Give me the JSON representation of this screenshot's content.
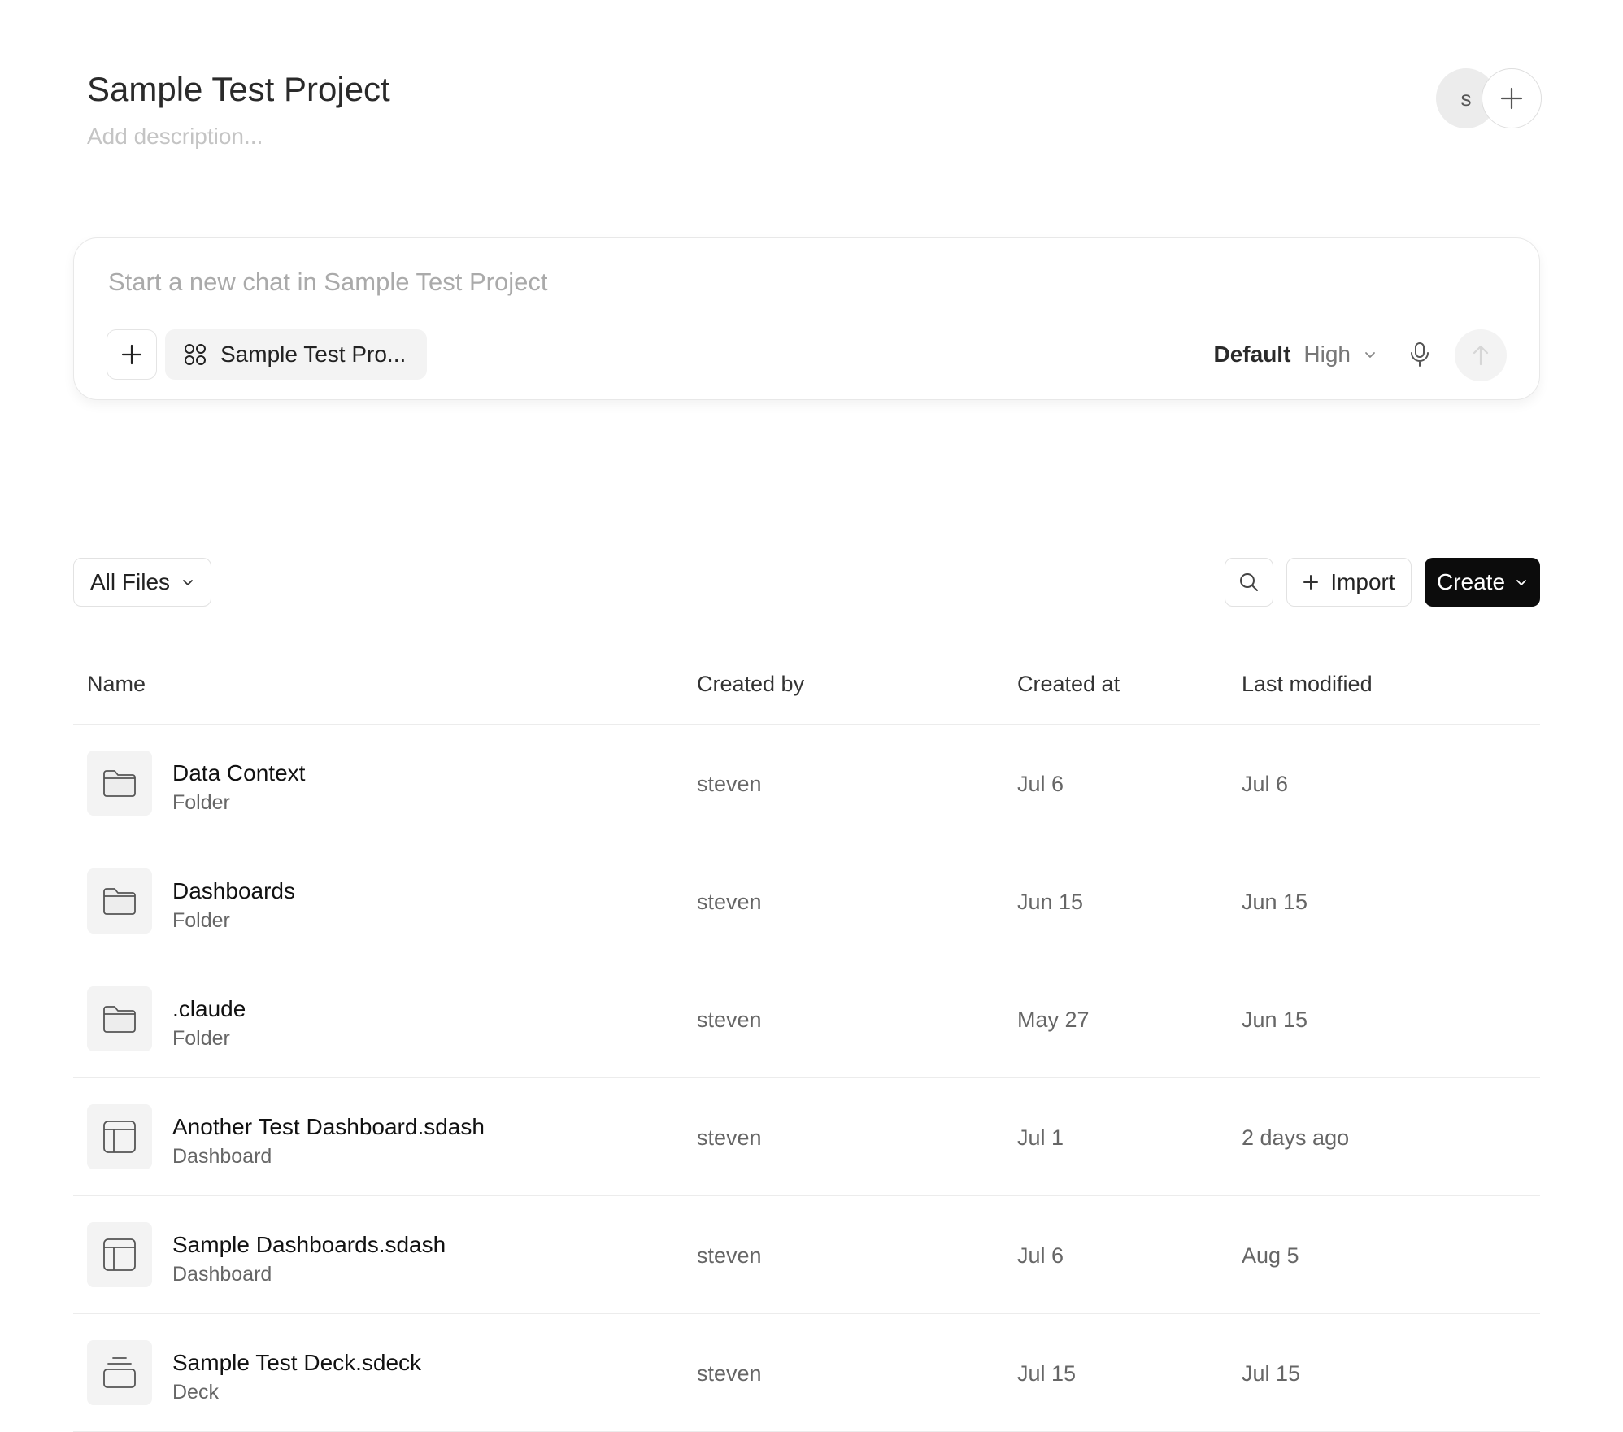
{
  "project": {
    "title": "Sample Test Project",
    "description_placeholder": "Add description...",
    "avatar_initial": "S"
  },
  "chat": {
    "placeholder": "Start a new chat in Sample Test Project",
    "project_chip_label": "Sample Test Pro...",
    "model_name": "Default",
    "model_level": "High"
  },
  "toolbar": {
    "filter_label": "All Files",
    "import_label": "Import",
    "create_label": "Create"
  },
  "table": {
    "headers": [
      "Name",
      "Created by",
      "Created at",
      "Last modified"
    ],
    "rows": [
      {
        "name": "Data Context",
        "type": "Folder",
        "icon": "folder-icon",
        "created_by": "steven",
        "created_at": "Jul 6",
        "modified": "Jul 6"
      },
      {
        "name": "Dashboards",
        "type": "Folder",
        "icon": "folder-icon",
        "created_by": "steven",
        "created_at": "Jun 15",
        "modified": "Jun 15"
      },
      {
        "name": ".claude",
        "type": "Folder",
        "icon": "folder-icon",
        "created_by": "steven",
        "created_at": "May 27",
        "modified": "Jun 15"
      },
      {
        "name": "Another Test Dashboard.sdash",
        "type": "Dashboard",
        "icon": "dashboard-icon",
        "created_by": "steven",
        "created_at": "Jul 1",
        "modified": "2 days ago"
      },
      {
        "name": "Sample Dashboards.sdash",
        "type": "Dashboard",
        "icon": "dashboard-icon",
        "created_by": "steven",
        "created_at": "Jul 6",
        "modified": "Aug 5"
      },
      {
        "name": "Sample Test Deck.sdeck",
        "type": "Deck",
        "icon": "deck-icon",
        "created_by": "steven",
        "created_at": "Jul 15",
        "modified": "Jul 15"
      }
    ]
  },
  "colors": {
    "create_button_bg": "#0c0c0c",
    "icon_tile_bg": "#f3f3f3",
    "border": "#e2e2e2"
  }
}
